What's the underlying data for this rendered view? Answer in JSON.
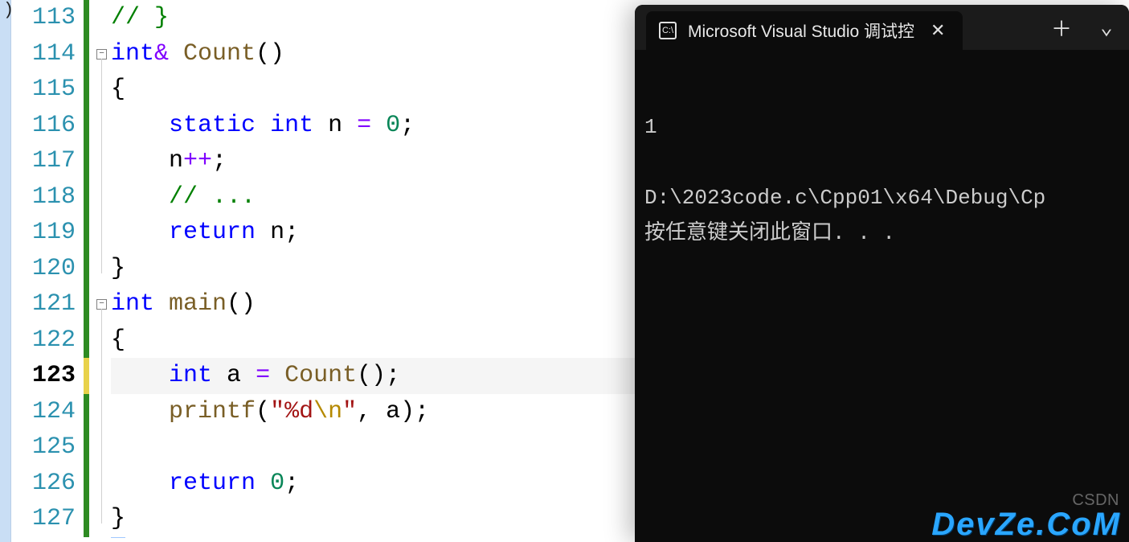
{
  "editor": {
    "lines": [
      {
        "num": "113",
        "code": [
          [
            "comment",
            "// }"
          ]
        ],
        "fold": null
      },
      {
        "num": "114",
        "code": [
          [
            "kw",
            "int"
          ],
          [
            "op",
            "& "
          ],
          [
            "func",
            "Count"
          ],
          [
            "punc",
            "()"
          ]
        ],
        "fold": "minus"
      },
      {
        "num": "115",
        "code": [
          [
            "punc",
            "{"
          ]
        ],
        "fold": null
      },
      {
        "num": "116",
        "code": [
          [
            "pad",
            "    "
          ],
          [
            "kw",
            "static"
          ],
          [
            "pad",
            " "
          ],
          [
            "kw",
            "int"
          ],
          [
            "pad",
            " "
          ],
          [
            "ident",
            "n "
          ],
          [
            "op",
            "="
          ],
          [
            "pad",
            " "
          ],
          [
            "num",
            "0"
          ],
          [
            "punc",
            ";"
          ]
        ],
        "fold": null
      },
      {
        "num": "117",
        "code": [
          [
            "pad",
            "    "
          ],
          [
            "ident",
            "n"
          ],
          [
            "op",
            "++"
          ],
          [
            "punc",
            ";"
          ]
        ],
        "fold": null
      },
      {
        "num": "118",
        "code": [
          [
            "pad",
            "    "
          ],
          [
            "comment",
            "// ..."
          ]
        ],
        "fold": null
      },
      {
        "num": "119",
        "code": [
          [
            "pad",
            "    "
          ],
          [
            "kw",
            "return"
          ],
          [
            "pad",
            " "
          ],
          [
            "ident",
            "n"
          ],
          [
            "punc",
            ";"
          ]
        ],
        "fold": null
      },
      {
        "num": "120",
        "code": [
          [
            "punc",
            "}"
          ]
        ],
        "fold": null
      },
      {
        "num": "121",
        "code": [
          [
            "kw",
            "int"
          ],
          [
            "pad",
            " "
          ],
          [
            "func",
            "main"
          ],
          [
            "punc",
            "()"
          ]
        ],
        "fold": "minus"
      },
      {
        "num": "122",
        "code": [
          [
            "punc",
            "{"
          ]
        ],
        "fold": null
      },
      {
        "num": "123",
        "code": [
          [
            "pad",
            "    "
          ],
          [
            "kw",
            "int"
          ],
          [
            "pad",
            " "
          ],
          [
            "ident",
            "a "
          ],
          [
            "op",
            "="
          ],
          [
            "pad",
            " "
          ],
          [
            "func",
            "Count"
          ],
          [
            "punc",
            "();"
          ]
        ],
        "fold": null,
        "active": true
      },
      {
        "num": "124",
        "code": [
          [
            "pad",
            "    "
          ],
          [
            "func",
            "printf"
          ],
          [
            "punc",
            "("
          ],
          [
            "str",
            "\"%d"
          ],
          [
            "esc",
            "\\n"
          ],
          [
            "str",
            "\""
          ],
          [
            "punc",
            ", "
          ],
          [
            "ident",
            "a"
          ],
          [
            "punc",
            ");"
          ]
        ],
        "fold": null
      },
      {
        "num": "125",
        "code": [],
        "fold": null
      },
      {
        "num": "126",
        "code": [
          [
            "pad",
            "    "
          ],
          [
            "kw",
            "return"
          ],
          [
            "pad",
            " "
          ],
          [
            "num",
            "0"
          ],
          [
            "punc",
            ";"
          ]
        ],
        "fold": null
      },
      {
        "num": "127",
        "code": [
          [
            "punc-u",
            "}"
          ]
        ],
        "fold": null
      }
    ]
  },
  "terminal": {
    "tab_title": "Microsoft Visual Studio 调试控",
    "icon_text": "C:\\",
    "output_line1": "1",
    "output_line2": "",
    "output_line3": "D:\\2023code.c\\Cpp01\\x64\\Debug\\Cp",
    "output_line4": "按任意键关闭此窗口. . ."
  },
  "watermark": {
    "csdn": "CSDN",
    "devze": "DevZe.CoM"
  },
  "icons": {
    "close": "✕",
    "plus": "＋",
    "chevron": "⌄"
  },
  "sliver_char": ")"
}
